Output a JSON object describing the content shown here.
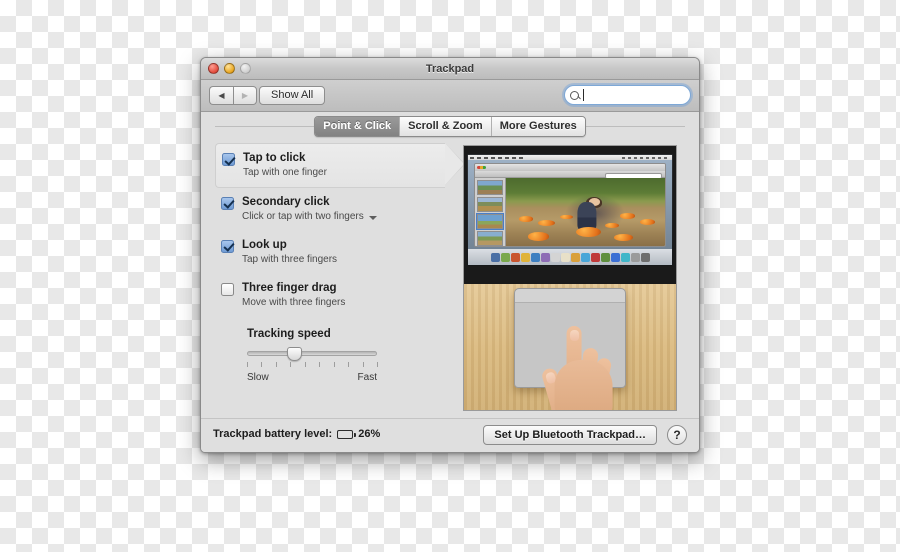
{
  "window": {
    "title": "Trackpad",
    "traffic_lights": [
      "close",
      "minimize",
      "zoom-disabled"
    ]
  },
  "toolbar": {
    "back_icon": "◀",
    "forward_icon": "▶",
    "show_all_label": "Show All",
    "search_placeholder": "",
    "search_value": "",
    "search_icon": "search-icon"
  },
  "tabs": [
    {
      "label": "Point & Click",
      "active": true
    },
    {
      "label": "Scroll & Zoom",
      "active": false
    },
    {
      "label": "More Gestures",
      "active": false
    }
  ],
  "options": [
    {
      "title": "Tap to click",
      "subtitle": "Tap with one finger",
      "checked": true,
      "selected": true,
      "has_popup": false
    },
    {
      "title": "Secondary click",
      "subtitle": "Click or tap with two fingers",
      "checked": true,
      "selected": false,
      "has_popup": true
    },
    {
      "title": "Look up",
      "subtitle": "Tap with three fingers",
      "checked": true,
      "selected": false,
      "has_popup": false
    },
    {
      "title": "Three finger drag",
      "subtitle": "Move with three fingers",
      "checked": false,
      "selected": false,
      "has_popup": false
    }
  ],
  "tracking_speed": {
    "label": "Tracking speed",
    "min_label": "Slow",
    "max_label": "Fast",
    "value_percent": 36,
    "tick_count": 10
  },
  "preview": {
    "description": "Demonstration video: hand tapping a Magic Trackpad with one finger, Mac display showing a photo app",
    "top_scene": "mac-display-photo-app",
    "bottom_scene": "hand-on-trackpad-wood-desk"
  },
  "bottom_bar": {
    "battery_label": "Trackpad battery level:",
    "battery_percent_text": "26%",
    "battery_level": 26,
    "setup_button_label": "Set Up Bluetooth Trackpad…",
    "help_button_label": "?"
  },
  "colors": {
    "window_bg": "#dfdfdf",
    "titlebar_top": "#dcdcdc",
    "titlebar_bottom": "#bcbcbc",
    "checkbox_checked": "#6f9bd4",
    "tab_active_bg": "#8e8e8e",
    "search_focus_ring": "#6ea0dc"
  }
}
